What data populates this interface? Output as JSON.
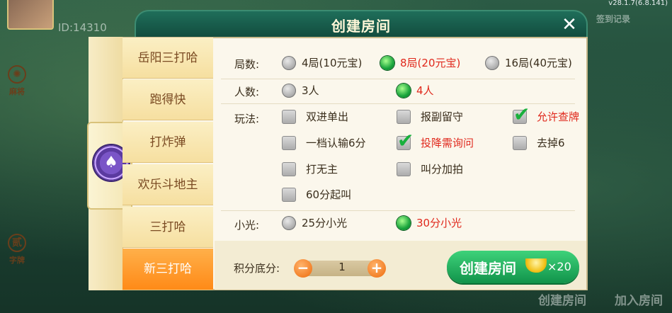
{
  "window": {
    "title": "创建房间",
    "version": "v28.1.7(6.8.141)"
  },
  "background": {
    "id_text": "ID:14310",
    "btn_create": "创建房间",
    "btn_join": "加入房间",
    "top_right_text": "签到记录"
  },
  "categories": [
    {
      "icon": "mahjong-icon",
      "label": "麻将"
    },
    {
      "icon": "poker-icon",
      "label": ""
    },
    {
      "icon": "zi-pai-icon",
      "label": "字牌",
      "glyph": "贰"
    }
  ],
  "game_tabs": [
    "岳阳三打哈",
    "跑得快",
    "打炸弹",
    "欢乐斗地主",
    "三打哈",
    "新三打哈"
  ],
  "active_tab": 5,
  "rounds": {
    "label": "局数:",
    "options": [
      {
        "text": "4局(10元宝)",
        "selected": false
      },
      {
        "text": "8局(20元宝)",
        "selected": true
      },
      {
        "text": "16局(40元宝)",
        "selected": false
      }
    ]
  },
  "players": {
    "label": "人数:",
    "options": [
      {
        "text": "3人",
        "selected": false
      },
      {
        "text": "4人",
        "selected": true
      }
    ]
  },
  "rules": {
    "label": "玩法:",
    "options": [
      {
        "text": "双进单出",
        "checked": false
      },
      {
        "text": "报副留守",
        "checked": false
      },
      {
        "text": "允许查牌",
        "checked": true
      },
      {
        "text": "一档认输6分",
        "checked": false
      },
      {
        "text": "投降需询问",
        "checked": true
      },
      {
        "text": "去掉6",
        "checked": false
      },
      {
        "text": "打无主",
        "checked": false
      },
      {
        "text": "叫分加拍",
        "checked": false
      },
      {
        "text": "60分起叫",
        "checked": false
      }
    ]
  },
  "small_light": {
    "label": "小光:",
    "options": [
      {
        "text": "25分小光",
        "selected": false
      },
      {
        "text": "30分小光",
        "selected": true
      }
    ]
  },
  "score": {
    "label": "积分底分:",
    "value": "1"
  },
  "create": {
    "label": "创建房间",
    "cost": "×20"
  }
}
